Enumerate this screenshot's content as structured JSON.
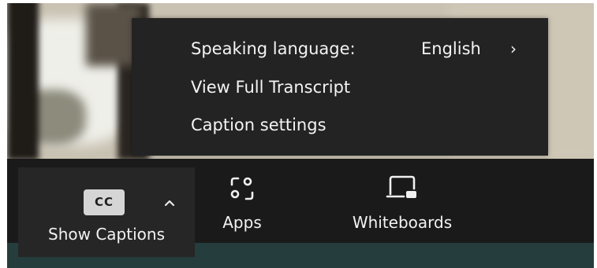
{
  "menu": {
    "speaking_language_label": "Speaking language:",
    "speaking_language_value": "English",
    "submenu_chevron": "›",
    "view_transcript_label": "View Full Transcript",
    "caption_settings_label": "Caption settings"
  },
  "toolbar": {
    "captions": {
      "icon_text": "CC",
      "label": "Show Captions",
      "caret": "^"
    },
    "apps": {
      "label": "Apps",
      "icon": "apps-icon"
    },
    "whiteboards": {
      "label": "Whiteboards",
      "icon": "whiteboard-icon"
    }
  },
  "colors": {
    "popup_bg": "#232323",
    "toolbar_bg": "#1a1a1a",
    "captions_btn_bg": "#262626",
    "bottom_strip": "#253d3c",
    "text": "#f4f4f4"
  }
}
